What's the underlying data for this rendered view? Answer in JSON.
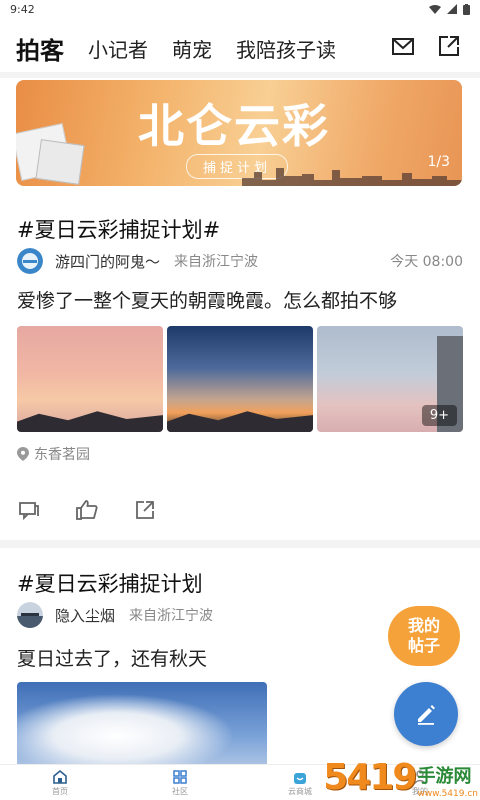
{
  "status_bar": {
    "time": "9:42"
  },
  "top_nav": {
    "tabs": [
      {
        "label": "拍客",
        "active": true
      },
      {
        "label": "小记者",
        "active": false
      },
      {
        "label": "萌宠",
        "active": false
      },
      {
        "label": "我陪孩子读",
        "active": false
      }
    ],
    "icons": [
      "mail-icon",
      "share-icon"
    ]
  },
  "banner": {
    "logo_text": "北仑云彩",
    "subtitle": "捕捉计划",
    "page_indicator": "1/3"
  },
  "posts": [
    {
      "title": "#夏日云彩捕捉计划#",
      "author": "游四门的阿鬼～",
      "source": "来自浙江宁波",
      "time": "今天 08:00",
      "text": "爱惨了一整个夏天的朝霞晚霞。怎么都拍不够",
      "more_count": "9+",
      "location": "东香茗园"
    },
    {
      "title": "#夏日云彩捕捉计划",
      "author": "隐入尘烟",
      "source": "来自浙江宁波",
      "text": "夏日过去了，还有秋天"
    }
  ],
  "fab": {
    "my_posts_line1": "我的",
    "my_posts_line2": "帖子"
  },
  "bottom_nav": {
    "items": [
      {
        "label": "首页",
        "active": true
      },
      {
        "label": "社区",
        "active": false
      },
      {
        "label": "云商城",
        "active": false
      },
      {
        "label": "我的",
        "active": false
      }
    ]
  },
  "watermark": {
    "number": "5419",
    "brand": "手游网",
    "url": "www.5419.cn"
  },
  "colors": {
    "accent_blue": "#1d5c8c",
    "fab_orange": "#f5a23a",
    "fab_blue": "#3d7fd1"
  }
}
